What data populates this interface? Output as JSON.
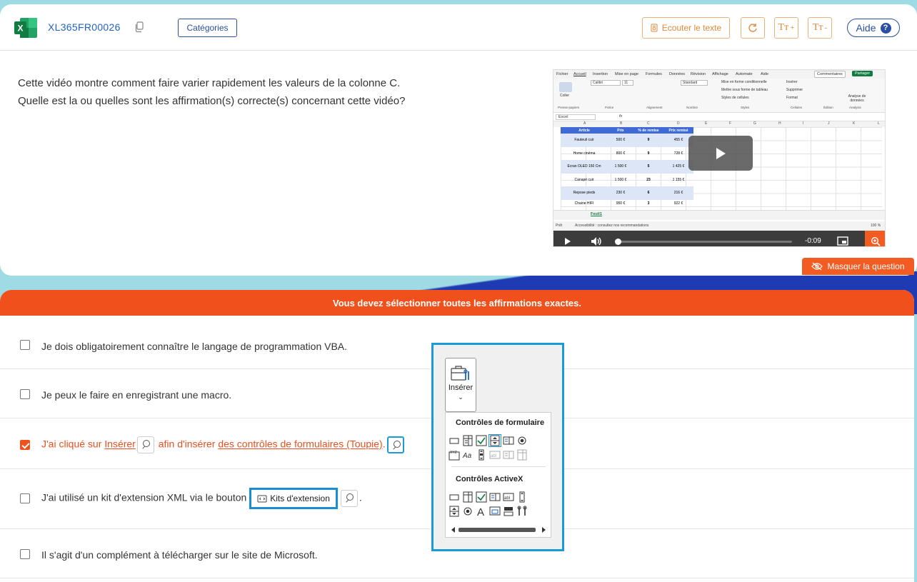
{
  "header": {
    "code": "XL365FR00026",
    "categories_label": "Catégories",
    "listen_label": "Ecouter le texte",
    "help_label": "Aide",
    "font_plus": "Tт",
    "font_minus": "Tт"
  },
  "question": {
    "line1": "Cette vidéo montre comment faire varier rapidement les valeurs de la colonne C.",
    "line2": "Quelle est la ou quelles sont les affirmation(s) correcte(s) concernant cette vidéo?"
  },
  "video": {
    "time": "-0:09",
    "progress": 0.0,
    "tabs": [
      "Fichier",
      "Accueil",
      "Insertion",
      "Mise en page",
      "Formules",
      "Données",
      "Révision",
      "Affichage",
      "Automate",
      "Aide"
    ],
    "comments_label": "Commentaires",
    "share_label": "Partager",
    "name_box": "Excel",
    "sheet_tab": "Feuil1",
    "status_left": "Prêt",
    "status_accessibility": "Accessibilité : consultez nos recommandations",
    "zoom": "100 %",
    "ribbon_groups": [
      "Presse-papiers",
      "Police",
      "Alignement",
      "Nombre",
      "Styles",
      "Cellules",
      "Édition",
      "Analysis"
    ],
    "ribbon_items": {
      "paste": "Coller",
      "font": "Calibri",
      "size": "11",
      "number_format": "Standard",
      "cond_format": "Mise en forme conditionnelle",
      "table_format": "Mettre sous forme de tableau",
      "cell_styles": "Styles de cellules",
      "insert": "Insérer",
      "delete": "Supprimer",
      "format": "Format",
      "analyze": "Analyse de données"
    },
    "columns": [
      "A",
      "B",
      "C",
      "D",
      "E",
      "F",
      "G",
      "H",
      "I",
      "J",
      "K",
      "L"
    ],
    "table_headers": [
      "Article",
      "Prix",
      "% de remise",
      "Prix remisé"
    ],
    "table_rows": [
      [
        "Fauteuil cuir",
        "500 €",
        "9",
        "455 €"
      ],
      [
        "Home cinéma",
        "800 €",
        "9",
        "728 €"
      ],
      [
        "Ecran OLED 150 Cm",
        "1 500 €",
        "5",
        "1 425 €"
      ],
      [
        "Canapé cuir",
        "1 500 €",
        "23",
        "1 155 €"
      ],
      [
        "Repose pieds",
        "230 €",
        "6",
        "216 €"
      ],
      [
        "Chaine HIFI",
        "950 €",
        "3",
        "922 €"
      ]
    ]
  },
  "hide_question_label": "Masquer la question",
  "banner": "Vous devez sélectionner toutes les affirmations exactes.",
  "options": [
    {
      "text": "Je dois obligatoirement connaître le langage de programmation VBA.",
      "checked": false
    },
    {
      "text": "Je peux le faire en enregistrant une macro.",
      "checked": false
    },
    {
      "prefix": "J'ai cliqué sur ",
      "link1": "Insérer",
      "middle": " afin d'insérer ",
      "link2": "des contrôles de formulaires (Toupie)",
      "suffix": ".",
      "checked": true
    },
    {
      "prefix": "J'ai utilisé un kit d'extension XML via le bouton ",
      "button": "Kits d'extension",
      "suffix": ".",
      "checked": false
    },
    {
      "text": "Il s'agit d'un complément à télécharger sur le site de Microsoft.",
      "checked": false
    }
  ],
  "popup": {
    "insert_label": "Insérer",
    "form_controls_title": "Contrôles de formulaire",
    "activex_title": "Contrôles ActiveX"
  },
  "colors": {
    "accent_orange": "#f0511c",
    "link_blue": "#1f63c4",
    "highlight_blue": "#1a9ad6",
    "excel_green": "#107c41"
  }
}
